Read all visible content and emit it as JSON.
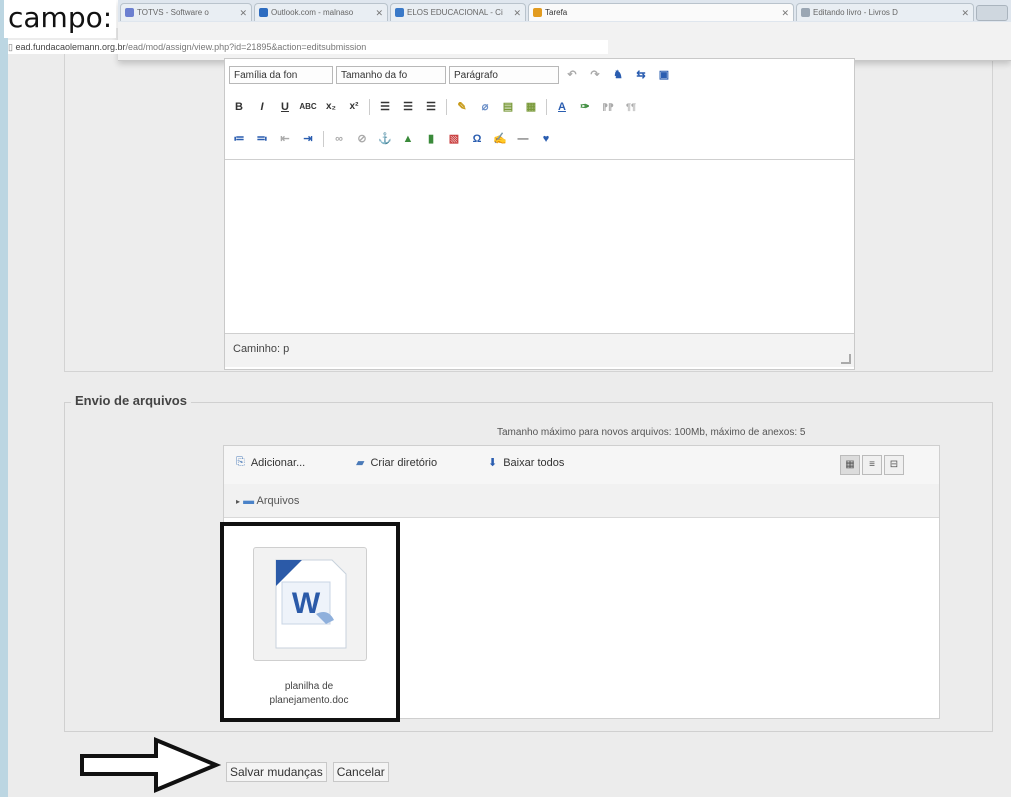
{
  "heading": "campo:",
  "browser": {
    "tabs": [
      {
        "label": "TOTVS - Software o",
        "color": "#6b7fd0",
        "active": false
      },
      {
        "label": "Outlook.com - malnaso",
        "color": "#2d6cc0",
        "active": false
      },
      {
        "label": "ELOS EDUCACIONAL - Ci",
        "color": "#3a79c8",
        "active": false
      },
      {
        "label": "Tarefa",
        "color": "#e29b1f",
        "active": true
      },
      {
        "label": "Editando livro - Livros D",
        "color": "#9aa6b3",
        "active": false
      }
    ],
    "url_host": "ead.fundacaolemann.org.br",
    "url_path": "/ead/mod/assign/view.php?id=21895&action=editsubmission"
  },
  "editor": {
    "font_family": "Família da fon",
    "font_size": "Tamanho da fo",
    "paragraph": "Parágrafo",
    "path_label": "Caminho: p"
  },
  "upload": {
    "legend": "Envio de arquivos",
    "max_size": "Tamanho máximo para novos arquivos: 100Mb, máximo de anexos: 5",
    "add_label": "Adicionar...",
    "create_dir_label": "Criar diretório",
    "download_all_label": "Baixar todos",
    "folder_label": "Arquivos",
    "file": {
      "name_line1": "planilha de",
      "name_line2": "planejamento.doc"
    }
  },
  "actions": {
    "save_label": "Salvar mudanças",
    "cancel_label": "Cancelar"
  },
  "colors": {
    "word_blue": "#2b5aa8",
    "highlight_border": "#111111",
    "accent_orange": "#e8852a"
  }
}
